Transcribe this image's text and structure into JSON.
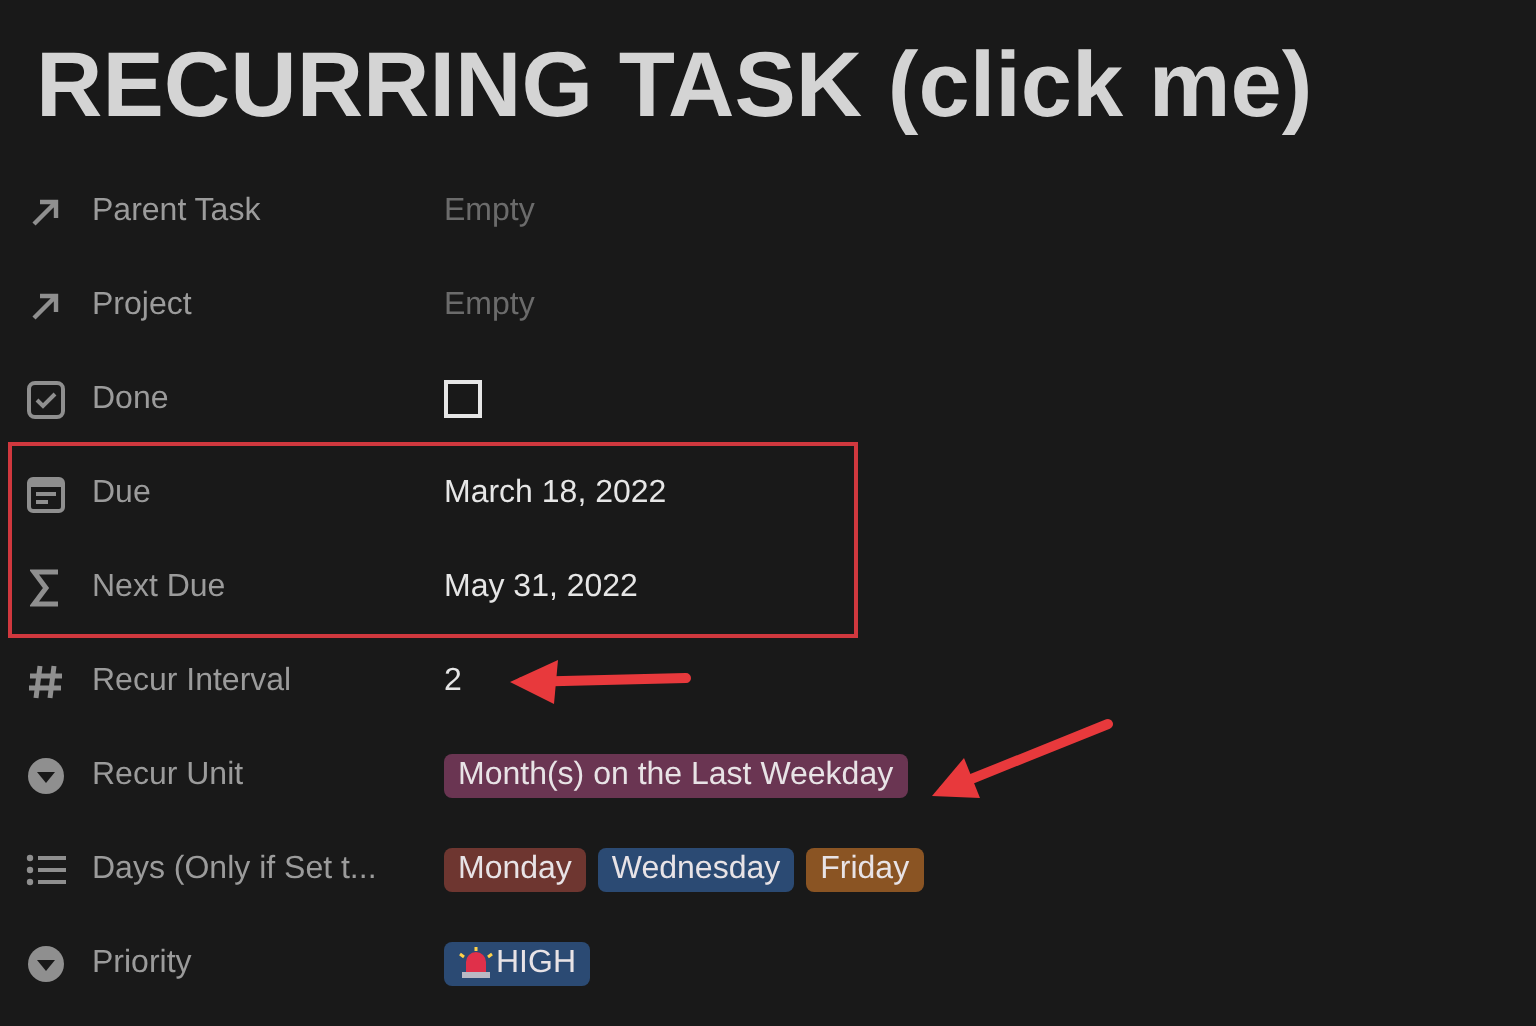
{
  "title": "RECURRING TASK (click me)",
  "properties": [
    {
      "kind": "relation",
      "label": "Parent Task",
      "value": "Empty",
      "empty": true,
      "highlighted": false,
      "arrow": false
    },
    {
      "kind": "relation",
      "label": "Project",
      "value": "Empty",
      "empty": true,
      "highlighted": false,
      "arrow": false
    },
    {
      "kind": "checkbox",
      "label": "Done",
      "checked": false,
      "highlighted": false,
      "arrow": false
    },
    {
      "kind": "date",
      "label": "Due",
      "value": "March 18, 2022",
      "highlighted": true,
      "arrow": false
    },
    {
      "kind": "formula",
      "label": "Next Due",
      "value": "May 31, 2022",
      "highlighted": true,
      "arrow": false
    },
    {
      "kind": "number",
      "label": "Recur Interval",
      "value": "2",
      "highlighted": false,
      "arrow": true
    },
    {
      "kind": "select",
      "label": "Recur Unit",
      "tags": [
        {
          "text": "Month(s) on the Last Weekday",
          "color": "#6a3552"
        }
      ],
      "highlighted": false,
      "arrow": true
    },
    {
      "kind": "multi_select",
      "label": "Days (Only if Set t...",
      "tags": [
        {
          "text": "Monday",
          "color": "#6e3630"
        },
        {
          "text": "Wednesday",
          "color": "#2b4a73"
        },
        {
          "text": "Friday",
          "color": "#8a5423"
        }
      ],
      "highlighted": false,
      "arrow": false
    },
    {
      "kind": "select",
      "label": "Priority",
      "tags": [
        {
          "text": "HIGH",
          "color": "#2b4a73",
          "siren": true
        }
      ],
      "highlighted": false,
      "arrow": false
    }
  ]
}
